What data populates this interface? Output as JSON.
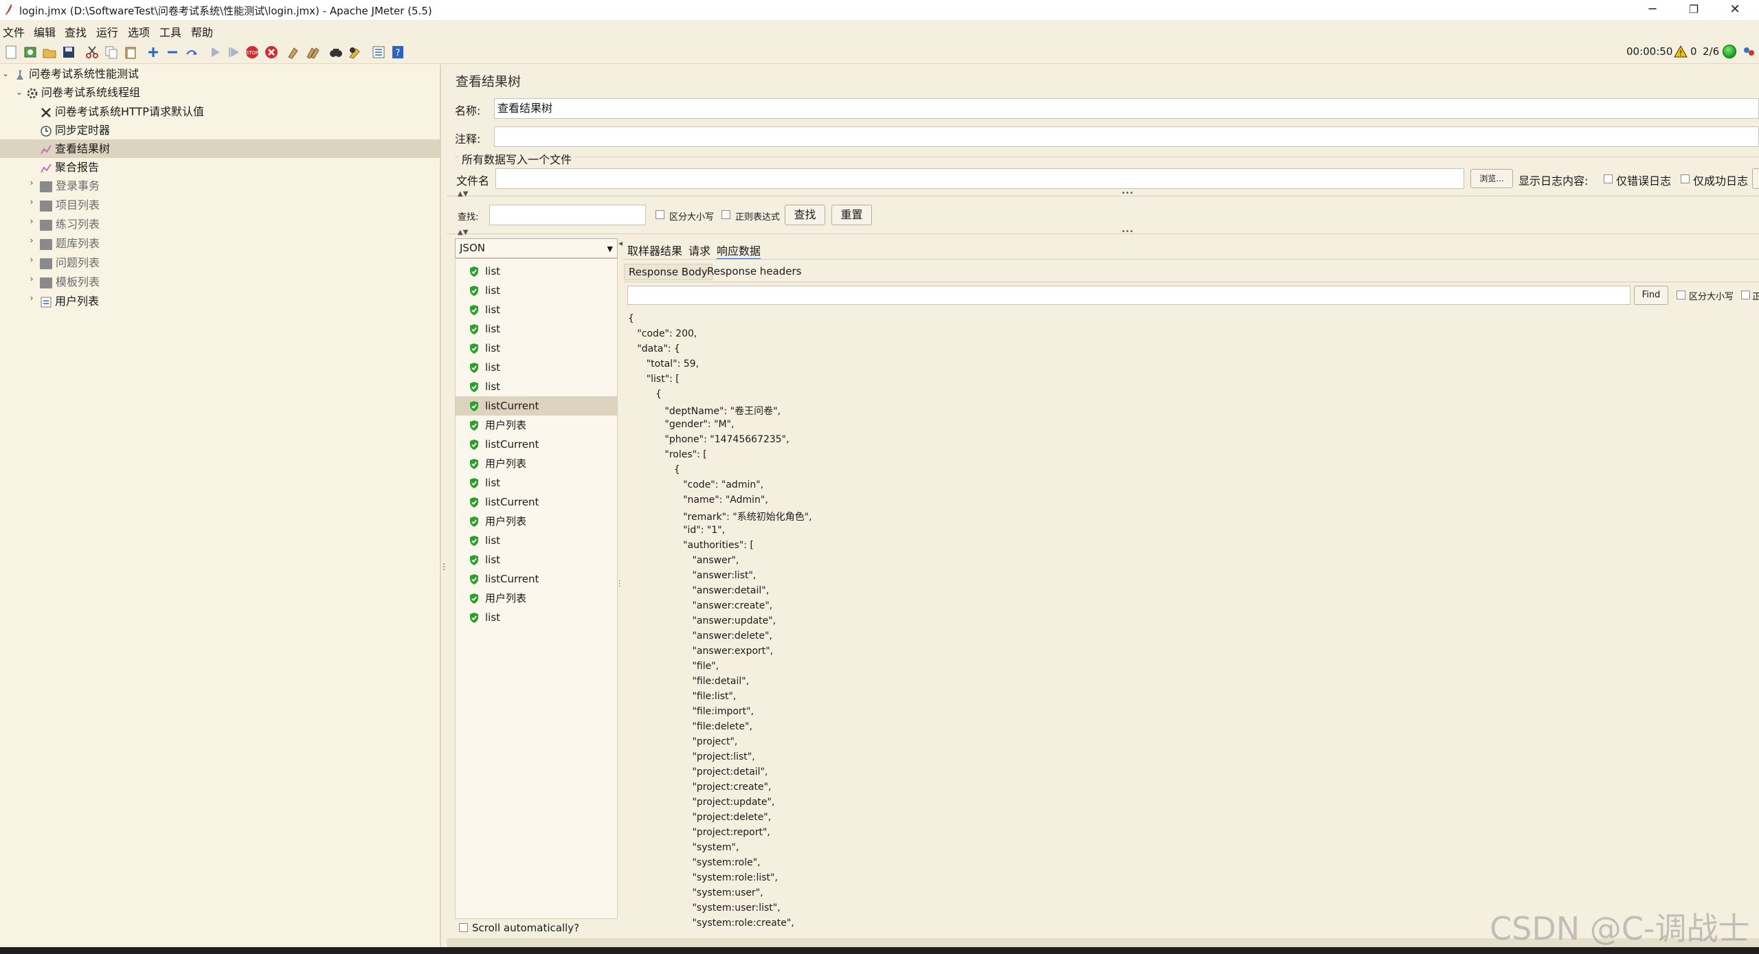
{
  "window": {
    "title": "login.jmx (D:\\SoftwareTest\\问卷考试系统\\性能测试\\login.jmx) - Apache JMeter (5.5)",
    "minimize": "─",
    "restore": "❐",
    "close": "✕"
  },
  "menu": [
    "文件",
    "编辑",
    "查找",
    "运行",
    "选项",
    "工具",
    "帮助"
  ],
  "toolbar_status": {
    "elapsed": "00:00:50",
    "errors": "0",
    "threads": "2/6"
  },
  "tree": {
    "root": "问卷考试系统性能测试",
    "thread_group": "问卷考试系统线程组",
    "children": [
      "问卷考试系统HTTP请求默认值",
      "同步定时器",
      "查看结果树",
      "聚合报告"
    ],
    "controllers": [
      "登录事务",
      "项目列表",
      "练习列表",
      "题库列表",
      "问题列表",
      "模板列表",
      "用户列表"
    ]
  },
  "panel": {
    "title": "查看结果树",
    "name_label": "名称:",
    "name_value": "查看结果树",
    "comment_label": "注释:",
    "comment_value": "",
    "file_group": "所有数据写入一个文件",
    "file_label": "文件名",
    "file_value": "",
    "browse": "浏览...",
    "log_label": "显示日志内容:",
    "errors_only": "仅错误日志",
    "success_only": "仅成功日志",
    "search_label": "查找:",
    "search_value": "",
    "case_sensitive": "区分大小写",
    "regex": "正则表达式",
    "search_btn": "查找",
    "reset_btn": "重置"
  },
  "renderer": "JSON",
  "samples": [
    "list",
    "list",
    "list",
    "list",
    "list",
    "list",
    "list",
    "listCurrent",
    "用户列表",
    "listCurrent",
    "用户列表",
    "list",
    "listCurrent",
    "用户列表",
    "list",
    "list",
    "listCurrent",
    "用户列表",
    "list"
  ],
  "selected_sample_index": 7,
  "result_tabs": [
    "取样器结果",
    "请求",
    "响应数据"
  ],
  "active_result_tab": "响应数据",
  "response_tabs": [
    "Response Body",
    "Response headers"
  ],
  "find": {
    "value": "",
    "button": "Find",
    "case_label": "区分大小写",
    "regex_label": "正"
  },
  "scroll_auto": "Scroll automatically?",
  "response_lines": [
    "{",
    "   \"code\": 200,",
    "   \"data\": {",
    "      \"total\": 59,",
    "      \"list\": [",
    "         {",
    "            \"deptName\": \"卷王问卷\",",
    "            \"gender\": \"M\",",
    "            \"phone\": \"14745667235\",",
    "            \"roles\": [",
    "               {",
    "                  \"code\": \"admin\",",
    "                  \"name\": \"Admin\",",
    "                  \"remark\": \"系统初始化角色\",",
    "                  \"id\": \"1\",",
    "                  \"authorities\": [",
    "                     \"answer\",",
    "                     \"answer:list\",",
    "                     \"answer:detail\",",
    "                     \"answer:create\",",
    "                     \"answer:update\",",
    "                     \"answer:delete\",",
    "                     \"answer:export\",",
    "                     \"file\",",
    "                     \"file:detail\",",
    "                     \"file:list\",",
    "                     \"file:import\",",
    "                     \"file:delete\",",
    "                     \"project\",",
    "                     \"project:list\",",
    "                     \"project:detail\",",
    "                     \"project:create\",",
    "                     \"project:update\",",
    "                     \"project:delete\",",
    "                     \"project:report\",",
    "                     \"system\",",
    "                     \"system:role\",",
    "                     \"system:role:list\",",
    "                     \"system:user\",",
    "                     \"system:user:list\",",
    "                     \"system:role:create\","
  ],
  "watermark": "CSDN @C-调战士",
  "colors": {
    "background": "#f5efdf",
    "selection": "#ddd4bf",
    "success_shield": "#2aa12a",
    "active_tab": "#2b63c7"
  }
}
